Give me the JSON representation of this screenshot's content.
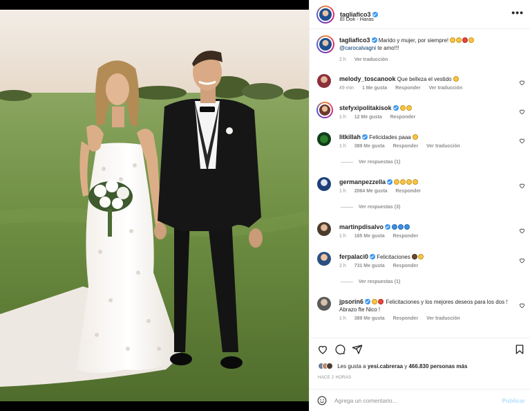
{
  "post": {
    "username": "tagliafico3",
    "location": "El Dok - Haras",
    "more_label": "•••"
  },
  "caption": {
    "username": "tagliafico3",
    "text": "Marido y mujer, por siempre!",
    "mention": "@carocalvagni",
    "text_after": "te amo!!!",
    "time": "2 h",
    "translate": "Ver traducción"
  },
  "comments": [
    {
      "username": "melody_toscanook",
      "text": "Que belleza el vestido",
      "time": "49 min",
      "likes": "1 Me gusta",
      "reply": "Responder",
      "translate": "Ver traducción",
      "verified": false
    },
    {
      "username": "stefyxipolitakisok",
      "text": "",
      "time": "1 h",
      "likes": "12 Me gusta",
      "reply": "Responder",
      "translate": "",
      "verified": true
    },
    {
      "username": "litkillah",
      "text": "Felicidades paaa",
      "time": "1 h",
      "likes": "389 Me gusta",
      "reply": "Responder",
      "translate": "Ver traducción",
      "verified": true,
      "replies": "Ver respuestas (1)"
    },
    {
      "username": "germanpezzella",
      "text": "",
      "time": "1 h",
      "likes": "2064 Me gusta",
      "reply": "Responder",
      "translate": "",
      "verified": true,
      "replies": "Ver respuestas (3)"
    },
    {
      "username": "martinpdisalvo",
      "text": "",
      "time": "1 h",
      "likes": "165 Me gusta",
      "reply": "Responder",
      "translate": "",
      "verified": true
    },
    {
      "username": "ferpalaci0",
      "text": "Felicitaciones",
      "time": "2 h",
      "likes": "731 Me gusta",
      "reply": "Responder",
      "translate": "",
      "verified": true,
      "replies": "Ver respuestas (1)"
    },
    {
      "username": "jpsorin6",
      "text": "Felicitaciones y los mejores deseos para los dos ! Abrazo fte Nico !",
      "time": "1 h",
      "likes": "389 Me gusta",
      "reply": "Responder",
      "translate": "Ver traducción",
      "verified": true
    }
  ],
  "likes": {
    "prefix": "Les gusta a",
    "user": "yesi.cabreraa",
    "middle": "y",
    "count": "466.830 personas",
    "suffix": "más"
  },
  "time_ago": "HACE 2 HORAS",
  "composer": {
    "placeholder": "Agrega un comentario...",
    "publish": "Publicar"
  },
  "colors": {
    "accent": "#3897f0",
    "link": "#00376b",
    "muted": "#8e8e8e",
    "publish_disabled": "#b2dffc"
  },
  "icons": [
    "heart-icon",
    "comment-icon",
    "share-icon",
    "bookmark-icon",
    "smile-icon",
    "verified-icon",
    "more-icon"
  ]
}
